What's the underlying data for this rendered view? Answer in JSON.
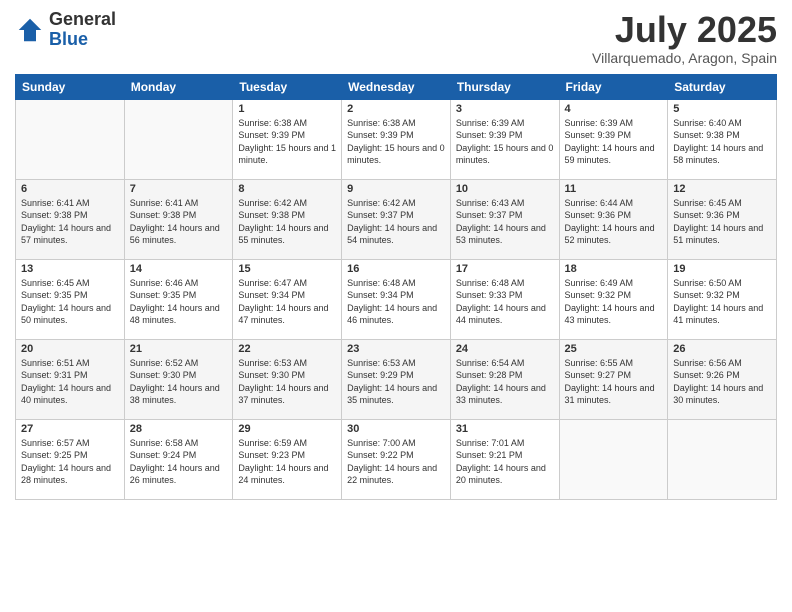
{
  "logo": {
    "general": "General",
    "blue": "Blue"
  },
  "title": "July 2025",
  "subtitle": "Villarquemado, Aragon, Spain",
  "weekdays": [
    "Sunday",
    "Monday",
    "Tuesday",
    "Wednesday",
    "Thursday",
    "Friday",
    "Saturday"
  ],
  "weeks": [
    [
      {
        "day": "",
        "info": ""
      },
      {
        "day": "",
        "info": ""
      },
      {
        "day": "1",
        "info": "Sunrise: 6:38 AM\nSunset: 9:39 PM\nDaylight: 15 hours and 1 minute."
      },
      {
        "day": "2",
        "info": "Sunrise: 6:38 AM\nSunset: 9:39 PM\nDaylight: 15 hours and 0 minutes."
      },
      {
        "day": "3",
        "info": "Sunrise: 6:39 AM\nSunset: 9:39 PM\nDaylight: 15 hours and 0 minutes."
      },
      {
        "day": "4",
        "info": "Sunrise: 6:39 AM\nSunset: 9:39 PM\nDaylight: 14 hours and 59 minutes."
      },
      {
        "day": "5",
        "info": "Sunrise: 6:40 AM\nSunset: 9:38 PM\nDaylight: 14 hours and 58 minutes."
      }
    ],
    [
      {
        "day": "6",
        "info": "Sunrise: 6:41 AM\nSunset: 9:38 PM\nDaylight: 14 hours and 57 minutes."
      },
      {
        "day": "7",
        "info": "Sunrise: 6:41 AM\nSunset: 9:38 PM\nDaylight: 14 hours and 56 minutes."
      },
      {
        "day": "8",
        "info": "Sunrise: 6:42 AM\nSunset: 9:38 PM\nDaylight: 14 hours and 55 minutes."
      },
      {
        "day": "9",
        "info": "Sunrise: 6:42 AM\nSunset: 9:37 PM\nDaylight: 14 hours and 54 minutes."
      },
      {
        "day": "10",
        "info": "Sunrise: 6:43 AM\nSunset: 9:37 PM\nDaylight: 14 hours and 53 minutes."
      },
      {
        "day": "11",
        "info": "Sunrise: 6:44 AM\nSunset: 9:36 PM\nDaylight: 14 hours and 52 minutes."
      },
      {
        "day": "12",
        "info": "Sunrise: 6:45 AM\nSunset: 9:36 PM\nDaylight: 14 hours and 51 minutes."
      }
    ],
    [
      {
        "day": "13",
        "info": "Sunrise: 6:45 AM\nSunset: 9:35 PM\nDaylight: 14 hours and 50 minutes."
      },
      {
        "day": "14",
        "info": "Sunrise: 6:46 AM\nSunset: 9:35 PM\nDaylight: 14 hours and 48 minutes."
      },
      {
        "day": "15",
        "info": "Sunrise: 6:47 AM\nSunset: 9:34 PM\nDaylight: 14 hours and 47 minutes."
      },
      {
        "day": "16",
        "info": "Sunrise: 6:48 AM\nSunset: 9:34 PM\nDaylight: 14 hours and 46 minutes."
      },
      {
        "day": "17",
        "info": "Sunrise: 6:48 AM\nSunset: 9:33 PM\nDaylight: 14 hours and 44 minutes."
      },
      {
        "day": "18",
        "info": "Sunrise: 6:49 AM\nSunset: 9:32 PM\nDaylight: 14 hours and 43 minutes."
      },
      {
        "day": "19",
        "info": "Sunrise: 6:50 AM\nSunset: 9:32 PM\nDaylight: 14 hours and 41 minutes."
      }
    ],
    [
      {
        "day": "20",
        "info": "Sunrise: 6:51 AM\nSunset: 9:31 PM\nDaylight: 14 hours and 40 minutes."
      },
      {
        "day": "21",
        "info": "Sunrise: 6:52 AM\nSunset: 9:30 PM\nDaylight: 14 hours and 38 minutes."
      },
      {
        "day": "22",
        "info": "Sunrise: 6:53 AM\nSunset: 9:30 PM\nDaylight: 14 hours and 37 minutes."
      },
      {
        "day": "23",
        "info": "Sunrise: 6:53 AM\nSunset: 9:29 PM\nDaylight: 14 hours and 35 minutes."
      },
      {
        "day": "24",
        "info": "Sunrise: 6:54 AM\nSunset: 9:28 PM\nDaylight: 14 hours and 33 minutes."
      },
      {
        "day": "25",
        "info": "Sunrise: 6:55 AM\nSunset: 9:27 PM\nDaylight: 14 hours and 31 minutes."
      },
      {
        "day": "26",
        "info": "Sunrise: 6:56 AM\nSunset: 9:26 PM\nDaylight: 14 hours and 30 minutes."
      }
    ],
    [
      {
        "day": "27",
        "info": "Sunrise: 6:57 AM\nSunset: 9:25 PM\nDaylight: 14 hours and 28 minutes."
      },
      {
        "day": "28",
        "info": "Sunrise: 6:58 AM\nSunset: 9:24 PM\nDaylight: 14 hours and 26 minutes."
      },
      {
        "day": "29",
        "info": "Sunrise: 6:59 AM\nSunset: 9:23 PM\nDaylight: 14 hours and 24 minutes."
      },
      {
        "day": "30",
        "info": "Sunrise: 7:00 AM\nSunset: 9:22 PM\nDaylight: 14 hours and 22 minutes."
      },
      {
        "day": "31",
        "info": "Sunrise: 7:01 AM\nSunset: 9:21 PM\nDaylight: 14 hours and 20 minutes."
      },
      {
        "day": "",
        "info": ""
      },
      {
        "day": "",
        "info": ""
      }
    ]
  ]
}
